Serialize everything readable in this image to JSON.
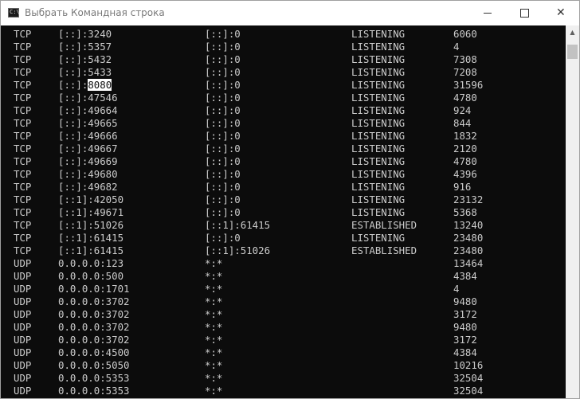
{
  "window": {
    "title": "Выбрать Командная строка",
    "icon": "console-icon",
    "icon_glyph": "C:\\",
    "minimize": "minimize-icon",
    "maximize": "maximize-icon",
    "close": "close-icon",
    "close_glyph": "✕",
    "scroll_up_glyph": "▲"
  },
  "console": {
    "selection": "8080",
    "rows": [
      {
        "proto": "TCP",
        "local": "[::]:3240",
        "foreign": "[::]:0",
        "state": "LISTENING",
        "pid": "6060"
      },
      {
        "proto": "TCP",
        "local": "[::]:5357",
        "foreign": "[::]:0",
        "state": "LISTENING",
        "pid": "4"
      },
      {
        "proto": "TCP",
        "local": "[::]:5432",
        "foreign": "[::]:0",
        "state": "LISTENING",
        "pid": "7308"
      },
      {
        "proto": "TCP",
        "local": "[::]:5433",
        "foreign": "[::]:0",
        "state": "LISTENING",
        "pid": "7208"
      },
      {
        "proto": "TCP",
        "local": "[::]:8080",
        "foreign": "[::]:0",
        "state": "LISTENING",
        "pid": "31596"
      },
      {
        "proto": "TCP",
        "local": "[::]:47546",
        "foreign": "[::]:0",
        "state": "LISTENING",
        "pid": "4780"
      },
      {
        "proto": "TCP",
        "local": "[::]:49664",
        "foreign": "[::]:0",
        "state": "LISTENING",
        "pid": "924"
      },
      {
        "proto": "TCP",
        "local": "[::]:49665",
        "foreign": "[::]:0",
        "state": "LISTENING",
        "pid": "844"
      },
      {
        "proto": "TCP",
        "local": "[::]:49666",
        "foreign": "[::]:0",
        "state": "LISTENING",
        "pid": "1832"
      },
      {
        "proto": "TCP",
        "local": "[::]:49667",
        "foreign": "[::]:0",
        "state": "LISTENING",
        "pid": "2120"
      },
      {
        "proto": "TCP",
        "local": "[::]:49669",
        "foreign": "[::]:0",
        "state": "LISTENING",
        "pid": "4780"
      },
      {
        "proto": "TCP",
        "local": "[::]:49680",
        "foreign": "[::]:0",
        "state": "LISTENING",
        "pid": "4396"
      },
      {
        "proto": "TCP",
        "local": "[::]:49682",
        "foreign": "[::]:0",
        "state": "LISTENING",
        "pid": "916"
      },
      {
        "proto": "TCP",
        "local": "[::1]:42050",
        "foreign": "[::]:0",
        "state": "LISTENING",
        "pid": "23132"
      },
      {
        "proto": "TCP",
        "local": "[::1]:49671",
        "foreign": "[::]:0",
        "state": "LISTENING",
        "pid": "5368"
      },
      {
        "proto": "TCP",
        "local": "[::1]:51026",
        "foreign": "[::1]:61415",
        "state": "ESTABLISHED",
        "pid": "13240"
      },
      {
        "proto": "TCP",
        "local": "[::1]:61415",
        "foreign": "[::]:0",
        "state": "LISTENING",
        "pid": "23480"
      },
      {
        "proto": "TCP",
        "local": "[::1]:61415",
        "foreign": "[::1]:51026",
        "state": "ESTABLISHED",
        "pid": "23480"
      },
      {
        "proto": "UDP",
        "local": "0.0.0.0:123",
        "foreign": "*:*",
        "state": "",
        "pid": "13464"
      },
      {
        "proto": "UDP",
        "local": "0.0.0.0:500",
        "foreign": "*:*",
        "state": "",
        "pid": "4384"
      },
      {
        "proto": "UDP",
        "local": "0.0.0.0:1701",
        "foreign": "*:*",
        "state": "",
        "pid": "4"
      },
      {
        "proto": "UDP",
        "local": "0.0.0.0:3702",
        "foreign": "*:*",
        "state": "",
        "pid": "9480"
      },
      {
        "proto": "UDP",
        "local": "0.0.0.0:3702",
        "foreign": "*:*",
        "state": "",
        "pid": "3172"
      },
      {
        "proto": "UDP",
        "local": "0.0.0.0:3702",
        "foreign": "*:*",
        "state": "",
        "pid": "9480"
      },
      {
        "proto": "UDP",
        "local": "0.0.0.0:3702",
        "foreign": "*:*",
        "state": "",
        "pid": "3172"
      },
      {
        "proto": "UDP",
        "local": "0.0.0.0:4500",
        "foreign": "*:*",
        "state": "",
        "pid": "4384"
      },
      {
        "proto": "UDP",
        "local": "0.0.0.0:5050",
        "foreign": "*:*",
        "state": "",
        "pid": "10216"
      },
      {
        "proto": "UDP",
        "local": "0.0.0.0:5353",
        "foreign": "*:*",
        "state": "",
        "pid": "32504"
      },
      {
        "proto": "UDP",
        "local": "0.0.0.0:5353",
        "foreign": "*:*",
        "state": "",
        "pid": "32504"
      }
    ]
  }
}
